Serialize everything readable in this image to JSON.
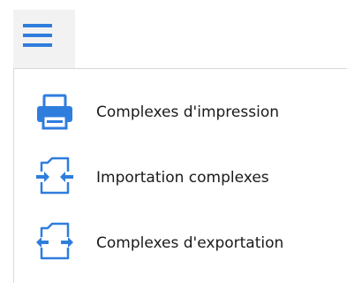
{
  "menu": {
    "button": {
      "icon": "hamburger-menu-icon"
    },
    "items": [
      {
        "label": "Complexes d'impression",
        "icon": "printer-icon"
      },
      {
        "label": "Importation complexes",
        "icon": "import-icon"
      },
      {
        "label": "Complexes d'exportation",
        "icon": "export-icon"
      }
    ]
  },
  "colors": {
    "accent": "#2f7ddd",
    "button_background": "#f2f2f2",
    "text": "#1a1a1a",
    "border": "#d9d9d9"
  }
}
